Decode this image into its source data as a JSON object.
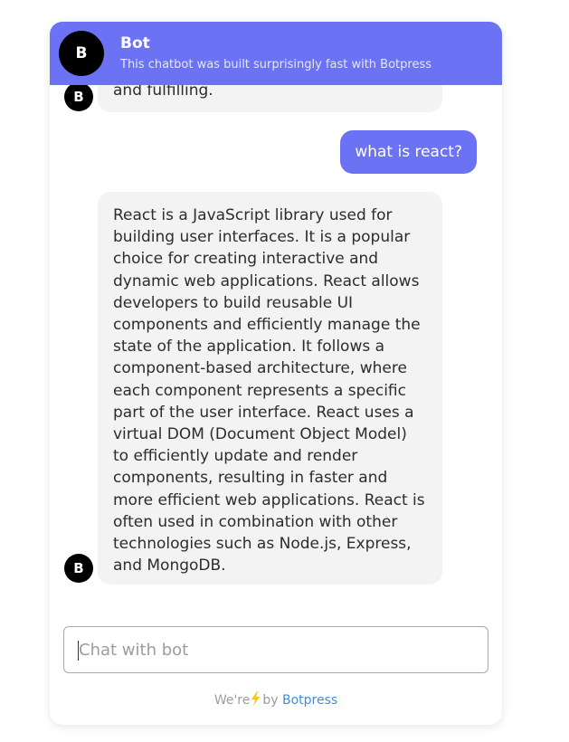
{
  "header": {
    "avatar_initial": "B",
    "title": "Bot",
    "subtitle": "This chatbot was built surprisingly fast with Botpress"
  },
  "messages": {
    "previous_tail": "and fulfilling.",
    "previous_avatar_initial": "B",
    "user_message": "what is react?",
    "bot_reply": "React is a JavaScript library used for building user interfaces. It is a popular choice for creating interactive and dynamic web applications. React allows developers to build reusable UI components and efficiently manage the state of the application. It follows a component-based architecture, where each component represents a specific part of the user interface. React uses a virtual DOM (Document Object Model) to efficiently update and render components, resulting in faster and more efficient web applications. React is often used in combination with other technologies such as Node.js, Express, and MongoDB.",
    "bot_reply_avatar_initial": "B"
  },
  "composer": {
    "placeholder": "Chat with bot",
    "value": ""
  },
  "footer": {
    "prefix": "We're",
    "icon": "lightning-bolt-icon",
    "by": "by",
    "link_label": "Botpress"
  },
  "colors": {
    "accent": "#6b73f4",
    "bot_bubble": "#f3f3f3",
    "avatar": "#000000",
    "link": "#3f8fd8",
    "bolt": "#f5c518"
  }
}
